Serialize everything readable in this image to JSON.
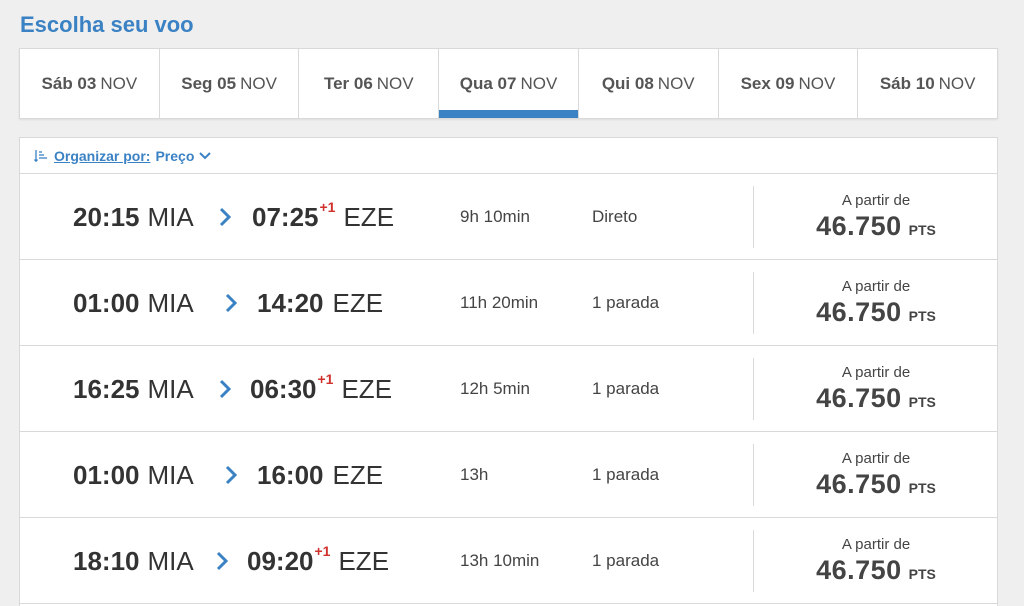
{
  "page": {
    "title": "Escolha seu voo"
  },
  "date_tabs": [
    {
      "dow": "Sáb 03",
      "month": "NOV",
      "active": false
    },
    {
      "dow": "Seg 05",
      "month": "NOV",
      "active": false
    },
    {
      "dow": "Ter 06",
      "month": "NOV",
      "active": false
    },
    {
      "dow": "Qua 07",
      "month": "NOV",
      "active": true
    },
    {
      "dow": "Qui 08",
      "month": "NOV",
      "active": false
    },
    {
      "dow": "Sex 09",
      "month": "NOV",
      "active": false
    },
    {
      "dow": "Sáb 10",
      "month": "NOV",
      "active": false
    }
  ],
  "sort": {
    "label": "Organizar por:",
    "value": "Preço"
  },
  "flights": [
    {
      "dep_time": "20:15",
      "dep_airport": "MIA",
      "arr_time": "07:25",
      "next_day": "+1",
      "arr_airport": "EZE",
      "duration": "9h 10min",
      "stops": "Direto",
      "from_label": "A partir de",
      "price": "46.750",
      "unit": "PTS"
    },
    {
      "dep_time": "01:00",
      "dep_airport": "MIA",
      "arr_time": "14:20",
      "next_day": "",
      "arr_airport": "EZE",
      "duration": "11h 20min",
      "stops": "1 parada",
      "from_label": "A partir de",
      "price": "46.750",
      "unit": "PTS"
    },
    {
      "dep_time": "16:25",
      "dep_airport": "MIA",
      "arr_time": "06:30",
      "next_day": "+1",
      "arr_airport": "EZE",
      "duration": "12h 5min",
      "stops": "1 parada",
      "from_label": "A partir de",
      "price": "46.750",
      "unit": "PTS"
    },
    {
      "dep_time": "01:00",
      "dep_airport": "MIA",
      "arr_time": "16:00",
      "next_day": "",
      "arr_airport": "EZE",
      "duration": "13h",
      "stops": "1 parada",
      "from_label": "A partir de",
      "price": "46.750",
      "unit": "PTS"
    },
    {
      "dep_time": "18:10",
      "dep_airport": "MIA",
      "arr_time": "09:20",
      "next_day": "+1",
      "arr_airport": "EZE",
      "duration": "13h 10min",
      "stops": "1 parada",
      "from_label": "A partir de",
      "price": "46.750",
      "unit": "PTS"
    }
  ],
  "colors": {
    "accent": "#3b82c4",
    "next_day": "#d0312d"
  }
}
